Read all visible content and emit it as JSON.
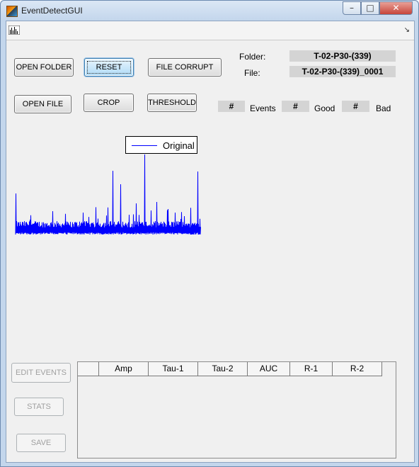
{
  "window": {
    "title": "EventDetectGUI",
    "controls": {
      "minimize": "–",
      "maximize": "□",
      "close": "✕"
    }
  },
  "toolbar": {
    "tool_icon": "plot-tools-icon",
    "expand_icon": "dock-arrow-icon",
    "expand_glyph": "↘"
  },
  "buttons": {
    "open_folder": "OPEN FOLDER",
    "reset": "RESET",
    "file_corrupt": "FILE CORRUPT",
    "open_file": "OPEN FILE",
    "crop": "CROP",
    "threshold": "THRESHOLD",
    "edit_events": "EDIT EVENTS",
    "stats": "STATS",
    "save": "SAVE"
  },
  "info": {
    "folder_label": "Folder:",
    "folder_value": "T-02-P30-(339)",
    "file_label": "File:",
    "file_value": "T-02-P30-(339)_0001"
  },
  "counts": {
    "events_value": "#",
    "events_label": "Events",
    "good_value": "#",
    "good_label": "Good",
    "bad_value": "#",
    "bad_label": "Bad"
  },
  "plot": {
    "legend": "Original",
    "line_color": "#0000ff"
  },
  "table": {
    "columns": [
      "Amp",
      "Tau-1",
      "Tau-2",
      "AUC",
      "R-1",
      "R-2"
    ]
  }
}
